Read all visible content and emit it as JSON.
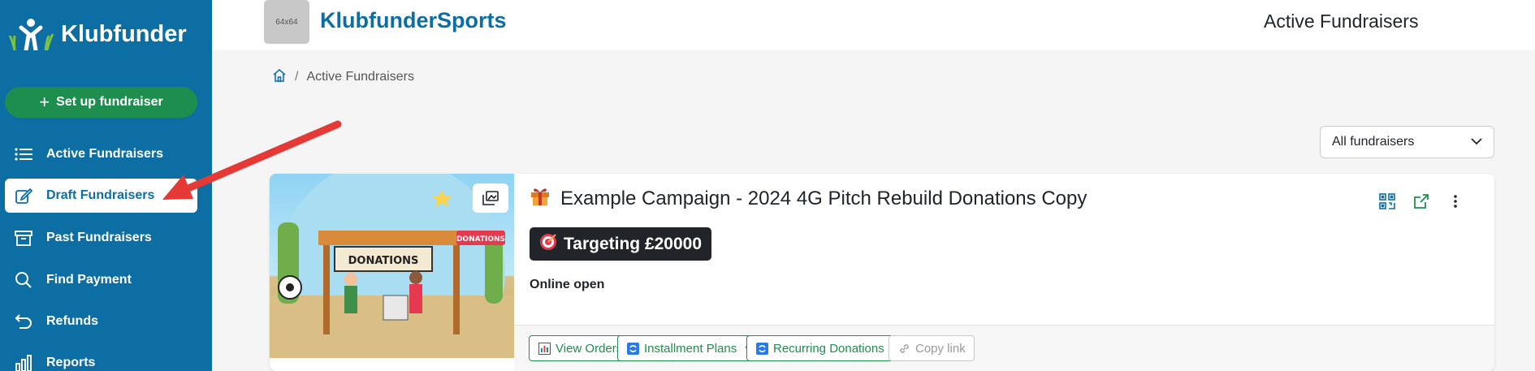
{
  "sidebar": {
    "brand_name": "Klubfunder",
    "setup_button": {
      "plus": "+",
      "label": "Set up fundraiser"
    },
    "items": [
      {
        "label": "Active Fundraisers",
        "icon": "list-icon"
      },
      {
        "label": "Draft Fundraisers",
        "icon": "pencil-square-icon",
        "active": true
      },
      {
        "label": "Past Fundraisers",
        "icon": "archive-icon"
      },
      {
        "label": "Find Payment",
        "icon": "search-icon"
      },
      {
        "label": "Refunds",
        "icon": "undo-arrow-icon"
      },
      {
        "label": "Reports",
        "icon": "bar-chart-icon"
      }
    ]
  },
  "header": {
    "club_logo_placeholder": "64x64",
    "club_name": "KlubfunderSports",
    "page_title": "Active Fundraisers"
  },
  "breadcrumb": {
    "home_icon": "home-icon",
    "separator": "/",
    "current": "Active Fundraisers"
  },
  "filter": {
    "selected": "All fundraisers"
  },
  "campaign_card": {
    "title": "Example Campaign - 2024 4G Pitch Rebuild Donations Copy",
    "title_icon": "gift-icon",
    "target_label": "Targeting £20000",
    "target_icon": "target-icon",
    "status": "Online open",
    "image_text": {
      "sign_main": "DONATIONS",
      "sign_side": "DONATIONS"
    },
    "actions": {
      "view_orders": "View Orders",
      "installment_plans": "Installment Plans",
      "recurring_donations": "Recurring Donations",
      "copy_link": "Copy link"
    }
  },
  "colors": {
    "sidebar_bg": "#0d6ea3",
    "accent_green": "#1e8e4e",
    "brand_blue": "#0d6ea3",
    "annotation_red": "#e53935"
  }
}
